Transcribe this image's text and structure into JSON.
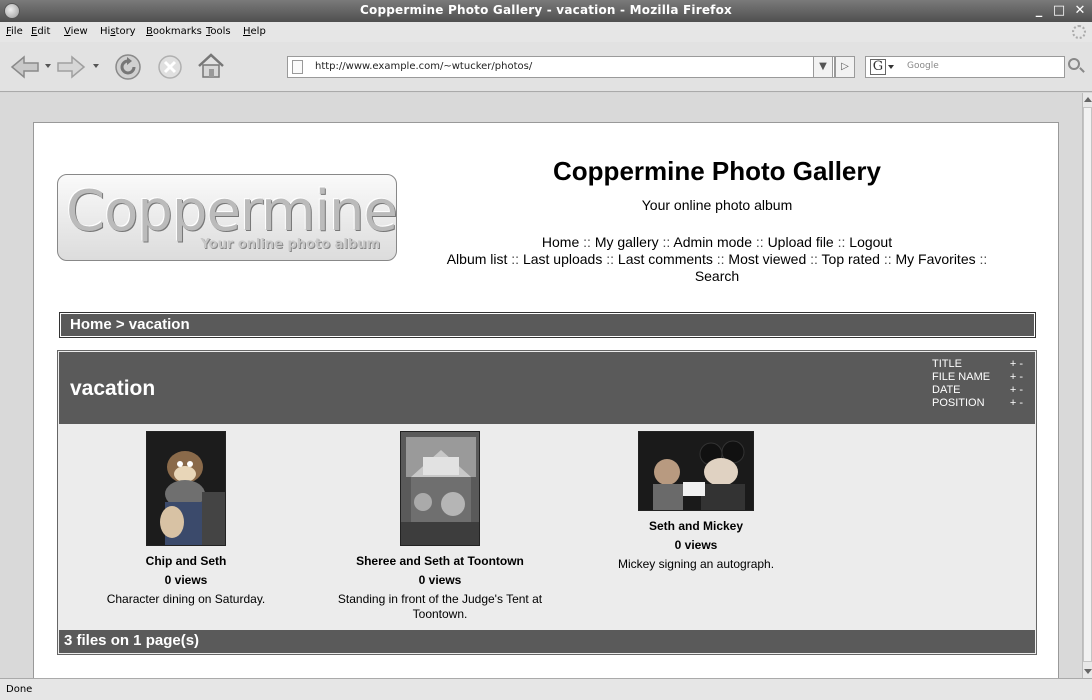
{
  "window": {
    "title": "Coppermine Photo Gallery - vacation - Mozilla Firefox"
  },
  "menu": {
    "items": [
      {
        "label": "File",
        "ul": "F",
        "rest": "ile"
      },
      {
        "label": "Edit",
        "ul": "E",
        "rest": "dit"
      },
      {
        "label": "View",
        "ul": "V",
        "rest": "iew"
      },
      {
        "label": "History",
        "pre": "Hi",
        "ul": "s",
        "rest": "tory"
      },
      {
        "label": "Bookmarks",
        "ul": "B",
        "rest": "ookmarks"
      },
      {
        "label": "Tools",
        "ul": "T",
        "rest": "ools"
      },
      {
        "label": "Help",
        "ul": "H",
        "rest": "elp"
      }
    ]
  },
  "navbar": {
    "url": "http://www.example.com/~wtucker/photos/",
    "search_placeholder": "Google"
  },
  "site": {
    "logo_text": "Coppermine",
    "logo_tagline": "Your online photo album",
    "title": "Coppermine Photo Gallery",
    "description": "Your online photo album",
    "nav_row1": [
      "Home",
      "My gallery",
      "Admin mode",
      "Upload file",
      "Logout"
    ],
    "nav_row2": [
      "Album list",
      "Last uploads",
      "Last comments",
      "Most viewed",
      "Top rated",
      "My Favorites",
      "Search"
    ],
    "separator": "::"
  },
  "breadcrumb": "Home > vacation",
  "album": {
    "name": "vacation",
    "sort": [
      {
        "label": "TITLE",
        "controls": "+ -"
      },
      {
        "label": "FILE NAME",
        "controls": "+ -"
      },
      {
        "label": "DATE",
        "controls": "+ -"
      },
      {
        "label": "POSITION",
        "controls": "+ -"
      }
    ],
    "photos": [
      {
        "title": "Chip and Seth",
        "views": "0 views",
        "description": "Character dining on Saturday."
      },
      {
        "title": "Sheree and Seth at Toontown",
        "views": "0 views",
        "description": "Standing in front of the Judge's Tent at Toontown."
      },
      {
        "title": "Seth and Mickey",
        "views": "0 views",
        "description": "Mickey signing an autograph."
      }
    ],
    "footer": "3 files on 1 page(s)"
  },
  "status": {
    "text": "Done"
  }
}
